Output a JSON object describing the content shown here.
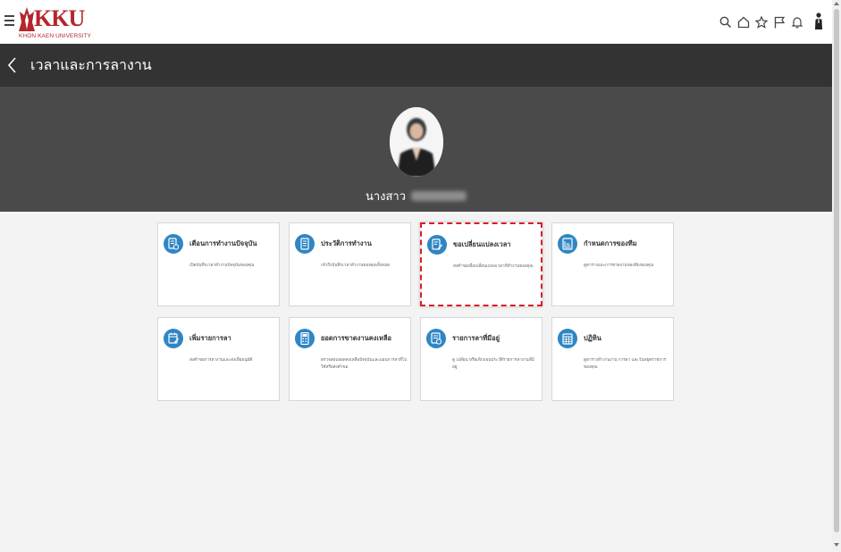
{
  "app": {
    "logo_text": "KKU",
    "logo_subtext": "KHON KAEN UNIVERSITY",
    "brand_color": "#b4262c"
  },
  "topbar": {
    "icons": [
      "search-icon",
      "home-icon",
      "star-icon",
      "flag-icon",
      "bell-icon",
      "user-avatar-icon"
    ]
  },
  "header": {
    "title": "เวลาและการลางาน"
  },
  "profile": {
    "name_prefix": "นางสาว"
  },
  "tiles": [
    {
      "title": "เตือนการทำงานปัจจุบัน",
      "description": "เปิดบันทึกเวลาทำงานปัจจุบันของคุณ",
      "icon": "clock-report-icon"
    },
    {
      "title": "ประวัติการทำงาน",
      "description": "เข้าถึงบันทึกเวลาทำงานของคุณทั้งหมด",
      "icon": "document-history-icon"
    },
    {
      "title": "ขอเปลี่ยนแปลงเวลา",
      "description": "ส่งคำขอเพื่อเปลี่ยนแปลงเวลาที่ทำงานของคุณ",
      "icon": "edit-document-icon",
      "highlighted": true
    },
    {
      "title": "กำหนดการของทีม",
      "description": "ดูตารางและการขาดงานของทีมของคุณ",
      "icon": "team-schedule-icon"
    },
    {
      "title": "เพิ่มรายการลา",
      "description": "ส่งคำขอการลางานและส่งเพื่ออนุมัติ",
      "icon": "calendar-add-icon"
    },
    {
      "title": "ยอดการขาดงานคงเหลือ",
      "description": "ตรวจสอบยอดคงเหลือปัจจุบันและแผนการลาที่ไปใช้หรือส่งคำขอ",
      "icon": "calculator-icon"
    },
    {
      "title": "รายการลาที่มีอยู่",
      "description": "ดู เปลี่ยน หรือเพิกถอนประวัติรายการลางานที่มีอยู่",
      "icon": "leave-list-icon"
    },
    {
      "title": "ปฏิทิน",
      "description": "ดูตารางทำงานงาน การลา และวันหยุดราชการของคุณ",
      "icon": "calendar-icon"
    }
  ]
}
